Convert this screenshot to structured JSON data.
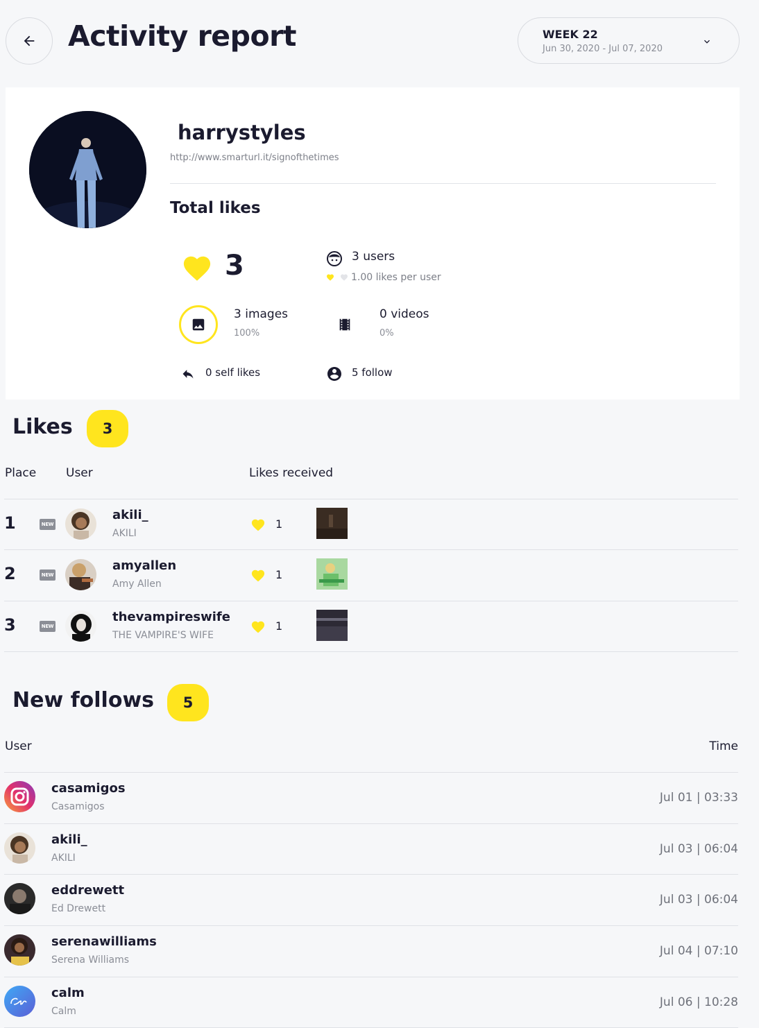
{
  "header": {
    "title": "Activity report",
    "week_label": "WEEK 22",
    "week_range": "Jun 30, 2020  -  Jul 07, 2020"
  },
  "profile": {
    "username": "harrystyles",
    "url": "http://www.smarturl.it/signofthetimes",
    "total_likes_title": "Total likes",
    "likes_total": "3",
    "users_count": "3 users",
    "likes_per_user": "1.00 likes per user",
    "images_count": "3 images",
    "images_pct": "100%",
    "videos_count": "0 videos",
    "videos_pct": "0%",
    "self_likes": "0 self likes",
    "follow_count": "5 follow"
  },
  "likes": {
    "title": "Likes",
    "count": "3",
    "headers": {
      "place": "Place",
      "user": "User",
      "likes_received": "Likes received"
    },
    "rows": [
      {
        "place": "1",
        "badge": "NEW",
        "user": "akili_",
        "name": "AKILI",
        "likes": "1"
      },
      {
        "place": "2",
        "badge": "NEW",
        "user": "amyallen",
        "name": "Amy Allen",
        "likes": "1"
      },
      {
        "place": "3",
        "badge": "NEW",
        "user": "thevampireswife",
        "name": "THE VAMPIRE'S WIFE",
        "likes": "1"
      }
    ]
  },
  "follows": {
    "title": "New follows",
    "count": "5",
    "headers": {
      "user": "User",
      "time": "Time"
    },
    "rows": [
      {
        "user": "casamigos",
        "name": "Casamigos",
        "time": "Jul 01 | 03:33"
      },
      {
        "user": "akili_",
        "name": "AKILI",
        "time": "Jul 03 | 06:04"
      },
      {
        "user": "eddrewett",
        "name": "Ed Drewett",
        "time": "Jul 03 | 06:04"
      },
      {
        "user": "serenawilliams",
        "name": "Serena Williams",
        "time": "Jul 04 | 07:10"
      },
      {
        "user": "calm",
        "name": "Calm",
        "time": "Jul 06 | 10:28"
      }
    ]
  },
  "icons": {
    "back": "arrow-left-icon",
    "dropdown": "chevron-down-icon",
    "heart": "heart-icon",
    "users": "face-icon",
    "images": "image-icon",
    "videos": "film-icon",
    "self_likes": "reply-icon",
    "follow": "account-circle-icon"
  },
  "colors": {
    "accent": "#ffe51e",
    "text": "#1b1b2f",
    "muted": "#8a8d96",
    "background": "#f6f7f9"
  }
}
